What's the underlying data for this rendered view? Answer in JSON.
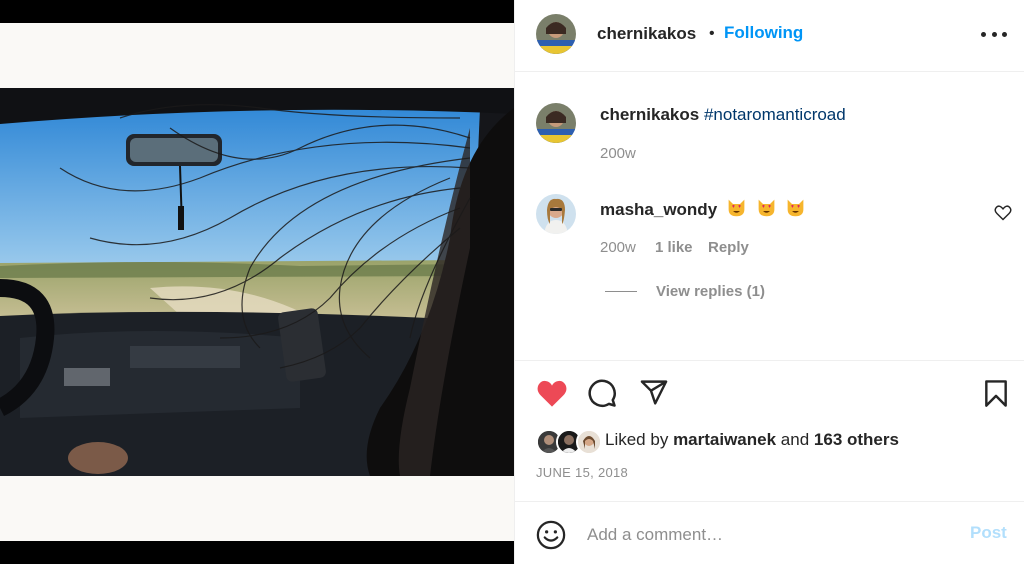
{
  "post": {
    "author": "chernikakos",
    "separator": "•",
    "follow_status": "Following",
    "more_icon": "more-horizontal-icon"
  },
  "caption": {
    "username": "chernikakos",
    "hashtag": "#notaromanticroad",
    "time": "200w"
  },
  "comments": [
    {
      "username": "masha_wondy",
      "emojis": [
        "heart-eyes-cat",
        "heart-eyes-cat",
        "heart-eyes-cat"
      ],
      "time": "200w",
      "likes": "1 like",
      "reply_label": "Reply",
      "like_icon": "heart-outline-icon",
      "view_replies": "View replies (1)"
    }
  ],
  "actions": {
    "like_icon": "heart-filled-icon",
    "comment_icon": "comment-icon",
    "share_icon": "paper-plane-icon",
    "save_icon": "bookmark-icon",
    "liked_color": "#ed4956"
  },
  "likes": {
    "prefix": "Liked by",
    "user": "martaiwanek",
    "conjunction": "and",
    "others": "163 others"
  },
  "date": "JUNE 15, 2018",
  "add_comment": {
    "placeholder": "Add a comment…",
    "post_label": "Post",
    "emoji_icon": "smiley-icon"
  },
  "colors": {
    "link_blue": "#0095f6",
    "hashtag": "#00376b",
    "muted": "#8e8e8e",
    "post_disabled": "#b2dffc"
  }
}
